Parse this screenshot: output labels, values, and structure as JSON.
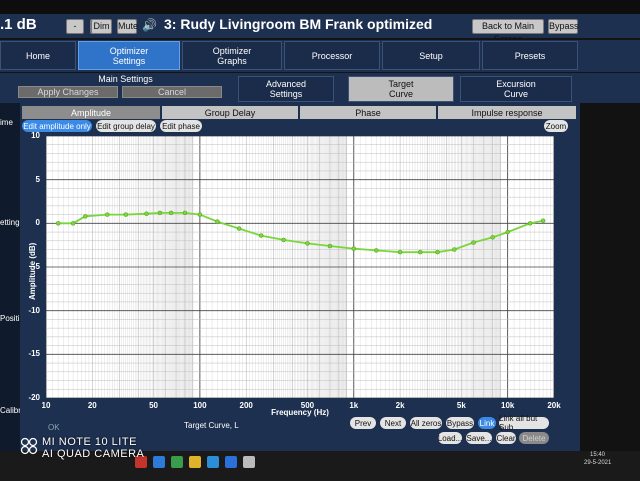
{
  "header": {
    "volume": ".1 dB",
    "minus": "-",
    "plus": "+",
    "dim": "Dim",
    "mute": "Mute",
    "speaker_icon": "speaker-icon",
    "title": "3: Rudy Livingroom BM Frank optimized",
    "back": "Back to Main Screen",
    "bypass": "Bypass"
  },
  "tabs": [
    {
      "label": "Home"
    },
    {
      "label": "Optimizer\nSettings",
      "active": true
    },
    {
      "label": "Optimizer\nGraphs"
    },
    {
      "label": "Processor"
    },
    {
      "label": "Setup"
    },
    {
      "label": "Presets"
    }
  ],
  "subtabs": {
    "main_settings": "Main Settings",
    "apply": "Apply Changes",
    "cancel": "Cancel",
    "advanced": "Advanced\nSettings",
    "target": "Target\nCurve",
    "excursion": "Excursion\nCurve"
  },
  "sidebar": [
    "ime",
    "ettings",
    "Positions",
    "Calibration"
  ],
  "graph_tabs": [
    "Amplitude",
    "Group Delay",
    "Phase",
    "Impulse response"
  ],
  "modes": [
    "Edit amplitude only",
    "Edit group delay",
    "Edit phase"
  ],
  "zoom": "Zoom",
  "chart_data": {
    "type": "line",
    "xscale": "log",
    "xlim": [
      10,
      20000
    ],
    "ylim": [
      -20,
      10
    ],
    "xlabel": "Frequency (Hz)",
    "ylabel": "Amplitude (dB)",
    "xticks": [
      "10",
      "20",
      "50",
      "100",
      "200",
      "500",
      "1k",
      "2k",
      "5k",
      "10k",
      "20k"
    ],
    "xtick_values": [
      10,
      20,
      50,
      100,
      200,
      500,
      1000,
      2000,
      5000,
      10000,
      20000
    ],
    "yticks": [
      10,
      5,
      0,
      -5,
      -10,
      -15,
      -20
    ],
    "grid": true,
    "x": [
      12,
      15,
      18,
      25,
      33,
      45,
      55,
      65,
      80,
      100,
      130,
      180,
      250,
      350,
      500,
      700,
      1000,
      1400,
      2000,
      2700,
      3500,
      4500,
      6000,
      8000,
      10000,
      14000,
      17000
    ],
    "y": [
      0,
      0,
      0.8,
      1.0,
      1.0,
      1.1,
      1.2,
      1.2,
      1.2,
      1.0,
      0.2,
      -0.6,
      -1.4,
      -1.9,
      -2.3,
      -2.6,
      -2.9,
      -3.1,
      -3.3,
      -3.3,
      -3.3,
      -3.0,
      -2.2,
      -1.6,
      -1.0,
      0,
      0.3
    ],
    "trace_color": "#7ad63a"
  },
  "footer": {
    "ok": "OK",
    "caption": "Target Curve, L",
    "prev": "Prev",
    "next": "Next",
    "allzeros": "All zeros",
    "bypass": "Bypass",
    "link": "Link",
    "linkall": "Link all but Sub",
    "load": "Load...",
    "save": "Save...",
    "clear": "Clear",
    "delete": "Delete"
  },
  "watermark": {
    "line1": "MI NOTE 10 LITE",
    "line2": "AI QUAD CAMERA"
  },
  "taskbar": {
    "time": "15:40",
    "date": "29-5-2021"
  }
}
